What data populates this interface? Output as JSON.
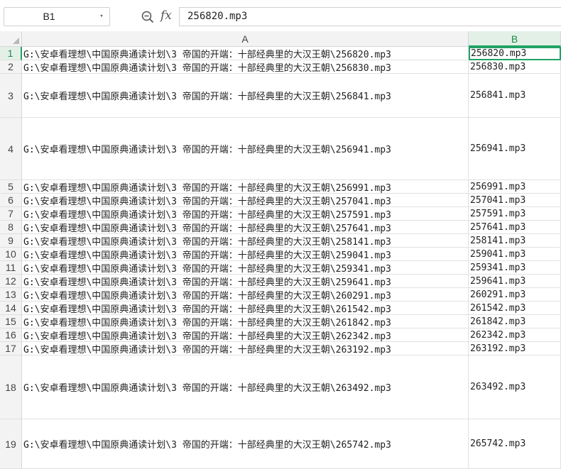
{
  "formula_bar": {
    "cell_ref": "B1",
    "fx_label": "fx",
    "formula_value": "256820.mp3",
    "namebox_caret": "▾"
  },
  "columns": [
    {
      "label": "A",
      "active": false
    },
    {
      "label": "B",
      "active": true
    }
  ],
  "active_cell": "B1",
  "accent_color": "#21a366",
  "rows": [
    {
      "num": "1",
      "a": "G:\\安卓看理想\\中国原典通读计划\\3 帝国的开端：十部经典里的大汉王朝\\256820.mp3",
      "b": "256820.mp3"
    },
    {
      "num": "2",
      "a": "G:\\安卓看理想\\中国原典通读计划\\3 帝国的开端：十部经典里的大汉王朝\\256830.mp3",
      "b": "256830.mp3"
    },
    {
      "num": "3",
      "a": "G:\\安卓看理想\\中国原典通读计划\\3 帝国的开端：十部经典里的大汉王朝\\256841.mp3",
      "b": "256841.mp3"
    },
    {
      "num": "4",
      "a": "G:\\安卓看理想\\中国原典通读计划\\3 帝国的开端：十部经典里的大汉王朝\\256941.mp3",
      "b": "256941.mp3"
    },
    {
      "num": "5",
      "a": "G:\\安卓看理想\\中国原典通读计划\\3 帝国的开端：十部经典里的大汉王朝\\256991.mp3",
      "b": "256991.mp3"
    },
    {
      "num": "6",
      "a": "G:\\安卓看理想\\中国原典通读计划\\3 帝国的开端：十部经典里的大汉王朝\\257041.mp3",
      "b": "257041.mp3"
    },
    {
      "num": "7",
      "a": "G:\\安卓看理想\\中国原典通读计划\\3 帝国的开端：十部经典里的大汉王朝\\257591.mp3",
      "b": "257591.mp3"
    },
    {
      "num": "8",
      "a": "G:\\安卓看理想\\中国原典通读计划\\3 帝国的开端：十部经典里的大汉王朝\\257641.mp3",
      "b": "257641.mp3"
    },
    {
      "num": "9",
      "a": "G:\\安卓看理想\\中国原典通读计划\\3 帝国的开端：十部经典里的大汉王朝\\258141.mp3",
      "b": "258141.mp3"
    },
    {
      "num": "10",
      "a": "G:\\安卓看理想\\中国原典通读计划\\3 帝国的开端：十部经典里的大汉王朝\\259041.mp3",
      "b": "259041.mp3"
    },
    {
      "num": "11",
      "a": "G:\\安卓看理想\\中国原典通读计划\\3 帝国的开端：十部经典里的大汉王朝\\259341.mp3",
      "b": "259341.mp3"
    },
    {
      "num": "12",
      "a": "G:\\安卓看理想\\中国原典通读计划\\3 帝国的开端：十部经典里的大汉王朝\\259641.mp3",
      "b": "259641.mp3"
    },
    {
      "num": "13",
      "a": "G:\\安卓看理想\\中国原典通读计划\\3 帝国的开端：十部经典里的大汉王朝\\260291.mp3",
      "b": "260291.mp3"
    },
    {
      "num": "14",
      "a": "G:\\安卓看理想\\中国原典通读计划\\3 帝国的开端：十部经典里的大汉王朝\\261542.mp3",
      "b": "261542.mp3"
    },
    {
      "num": "15",
      "a": "G:\\安卓看理想\\中国原典通读计划\\3 帝国的开端：十部经典里的大汉王朝\\261842.mp3",
      "b": "261842.mp3"
    },
    {
      "num": "16",
      "a": "G:\\安卓看理想\\中国原典通读计划\\3 帝国的开端：十部经典里的大汉王朝\\262342.mp3",
      "b": "262342.mp3"
    },
    {
      "num": "17",
      "a": "G:\\安卓看理想\\中国原典通读计划\\3 帝国的开端：十部经典里的大汉王朝\\263192.mp3",
      "b": "263192.mp3"
    },
    {
      "num": "18",
      "a": "G:\\安卓看理想\\中国原典通读计划\\3 帝国的开端：十部经典里的大汉王朝\\263492.mp3",
      "b": "263492.mp3"
    },
    {
      "num": "19",
      "a": "G:\\安卓看理想\\中国原典通读计划\\3 帝国的开端：十部经典里的大汉王朝\\265742.mp3",
      "b": "265742.mp3"
    }
  ]
}
